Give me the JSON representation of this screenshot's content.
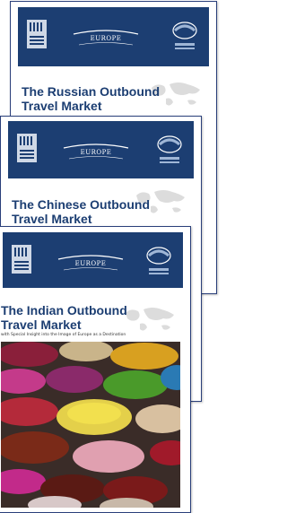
{
  "covers": [
    {
      "title_line1": "The Russian Outbound",
      "title_line2": "Travel Market",
      "logo_text": "EUROPE"
    },
    {
      "title_line1": "The Chinese Outbound",
      "title_line2": "Travel Market",
      "logo_text": "EUROPE"
    },
    {
      "title_line1": "The Indian Outbound",
      "title_line2": "Travel Market",
      "logo_text": "EUROPE",
      "subtitle": "with Special Insight into the Image of Europe as a Destination"
    }
  ],
  "colors": {
    "brand_blue": "#1c3e72",
    "title_blue": "#1c3e72",
    "frame": "#2a3f7a"
  },
  "icons": [
    "qr-code-icon",
    "europe-logo-icon",
    "etc-logo-icon",
    "world-map-icon"
  ]
}
